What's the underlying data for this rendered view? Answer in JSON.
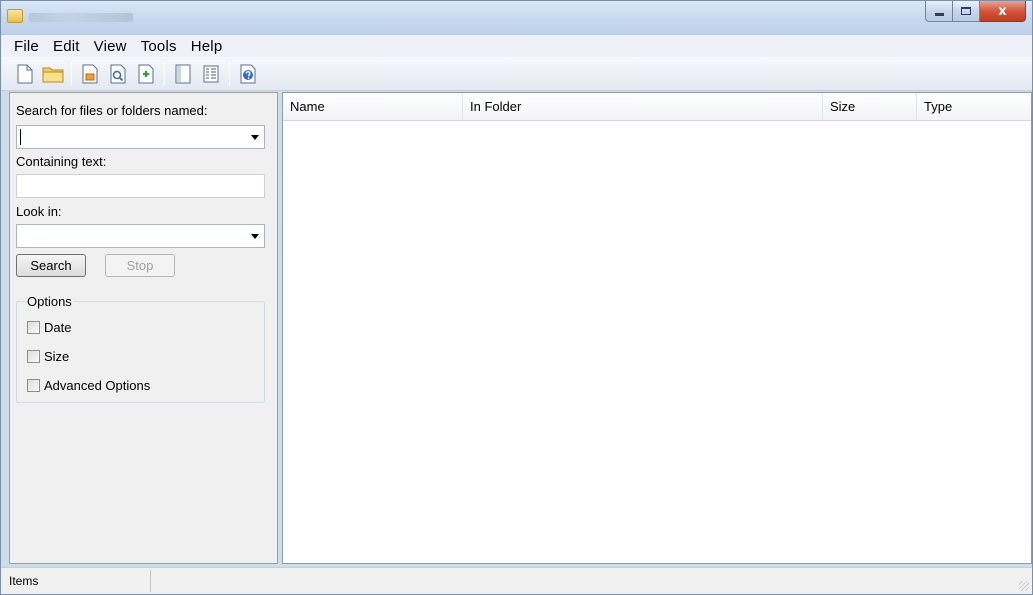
{
  "window": {
    "controls": {
      "minimize_icon": "minimize-icon",
      "maximize_icon": "maximize-icon",
      "close_glyph": "x"
    }
  },
  "menu": {
    "items": [
      "File",
      "Edit",
      "View",
      "Tools",
      "Help"
    ]
  },
  "toolbar": {
    "buttons": [
      "new-document-icon",
      "open-folder-icon",
      "save-icon",
      "preview-icon",
      "export-icon",
      "panel-layout-icon",
      "columns-icon",
      "help-icon"
    ]
  },
  "search_panel": {
    "named_label": "Search for files or folders named:",
    "named_value": "",
    "containing_label": "Containing text:",
    "containing_value": "",
    "lookin_label": "Look in:",
    "lookin_value": "",
    "search_button": "Search",
    "stop_button": "Stop",
    "options_title": "Options",
    "options": [
      "Date",
      "Size",
      "Advanced Options"
    ]
  },
  "results": {
    "columns": [
      "Name",
      "In Folder",
      "Size",
      "Type"
    ],
    "rows": []
  },
  "statusbar": {
    "text": "Items"
  },
  "colors": {
    "title_bar": "#c5d7ee",
    "close_button": "#d2573b",
    "panel_bg": "#f0f0f0"
  }
}
